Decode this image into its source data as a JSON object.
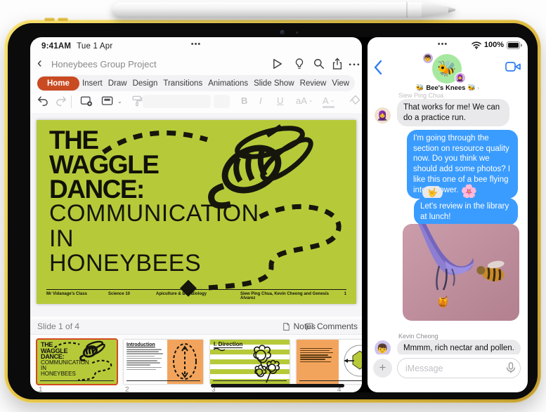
{
  "icons": {
    "dots": "•••",
    "back_chevron": "‹",
    "forward_chevron": "›",
    "chevron_down": "⌄",
    "plus": "+"
  },
  "left_app": {
    "status_time": "9:41AM",
    "status_date": "Tue 1 Apr",
    "title": "Honeybees Group Project",
    "ribbon_tabs": [
      "Home",
      "Insert",
      "Draw",
      "Design",
      "Transitions",
      "Animations",
      "Slide Show",
      "Review",
      "View"
    ],
    "toolbar": {
      "bold": "B",
      "italic": "I",
      "underline": "U",
      "case": "aA",
      "font_color": "A"
    },
    "slide": {
      "title_bold": [
        "THE",
        "WAGGLE",
        "DANCE:"
      ],
      "title_light": [
        "COMMUNICATION",
        "IN",
        "HONEYBEES"
      ],
      "footer": [
        "Mr Vidanage's Class",
        "Science 10",
        "Apiculture & Bee Biology",
        "Siew Ping Chua, Kevin Cheong and Genesis Alvarez",
        "1"
      ]
    },
    "status_line": {
      "slides": "Slide 1 of 4",
      "notes": "Notes",
      "comments": "Comments"
    },
    "thumbnails": [
      {
        "number": "1"
      },
      {
        "number": "2",
        "heading": "Introduction"
      },
      {
        "number": "3",
        "heading": "I. Direction"
      },
      {
        "number": "4"
      }
    ]
  },
  "right_app": {
    "battery": "100%",
    "group_name": "🐝 Bee's Knees 🐝",
    "avatar_bee": "🐝",
    "avatar_kevin": "👦",
    "avatar_siew": "🧕",
    "messages": {
      "m1_sender": "Siew Ping Chua",
      "m1_text": "That works for me! We can do a practice run.",
      "m2_text": "I'm going through the section on resource quality now. Do you think we should add some photos? I like this one of a bee flying into a flower.",
      "m2_emoji": "🌸",
      "m3_reaction": "🤟",
      "m3_text": "Let's review in the library at lunch!",
      "m4_sender": "Kevin Cheong",
      "m4_text": "Mmmm, rich nectar and pollen.",
      "photo_honey": "🍯"
    },
    "composer": {
      "placeholder": "iMessage"
    }
  },
  "colors": {
    "powerpoint_red": "#c94b22",
    "slide_green": "#b6ca39",
    "imessage_blue": "#3a9cfe",
    "thumb_orange": "#f3a45c",
    "ipad_yellow": "#e9c94d"
  }
}
